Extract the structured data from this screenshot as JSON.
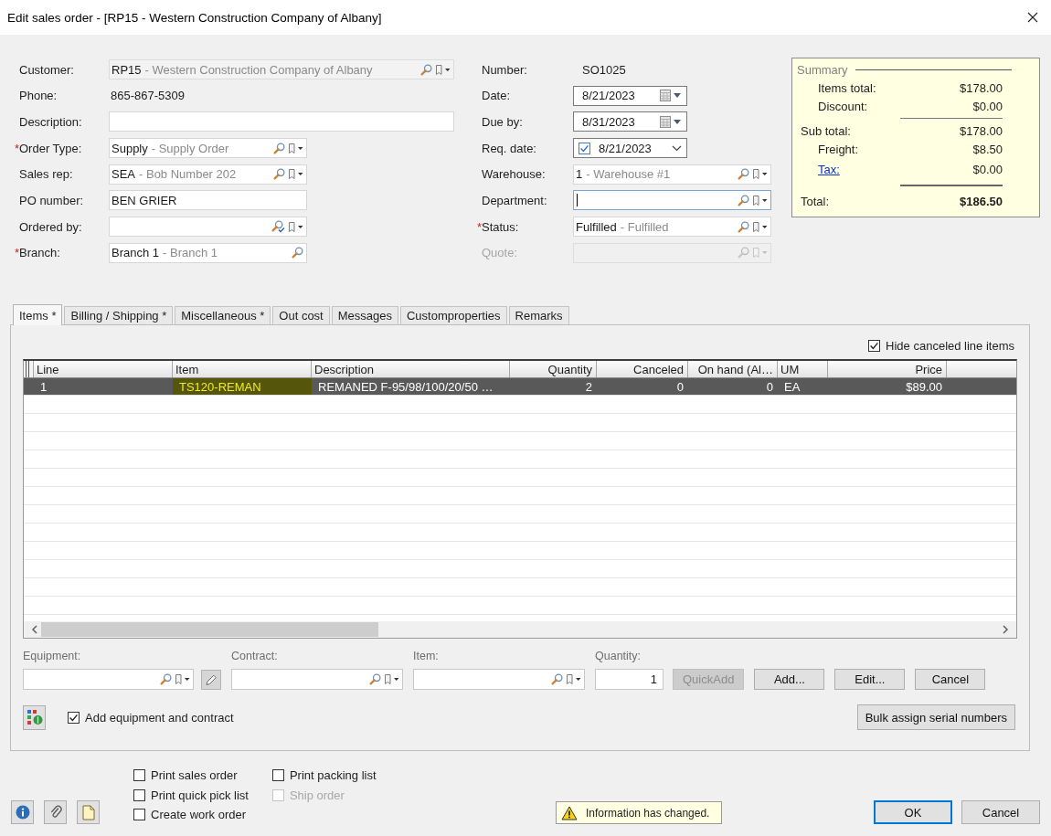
{
  "window": {
    "title": "Edit sales order - [RP15 - Western Construction Company of Albany]"
  },
  "form": {
    "left": [
      {
        "label": "Customer:",
        "kind": "readonly-lookup",
        "code": "RP15",
        "description": "- Western Construction Company of Albany",
        "disabled": false,
        "focused": false
      },
      {
        "label": "Phone:",
        "kind": "plain",
        "value": "865-867-5309",
        "disabled": false
      },
      {
        "label": "Description:",
        "kind": "text",
        "disabled": false,
        "focused": false
      },
      {
        "marker": "*",
        "label": "Order Type:",
        "kind": "lookup",
        "code": "Supply",
        "description": "- Supply Order",
        "disabled": false,
        "focused": false
      },
      {
        "label": "Sales rep:",
        "kind": "lookup",
        "code": "SEA",
        "description": "- Bob Number 202",
        "disabled": false,
        "focused": false
      },
      {
        "label": "PO number:",
        "kind": "text",
        "value": "BEN GRIER",
        "disabled": false,
        "focused": false
      },
      {
        "label": "Ordered by:",
        "kind": "contact-lookup",
        "disabled": false,
        "focused": false
      },
      {
        "marker": "*",
        "label": "Branch:",
        "kind": "search-lookup",
        "code": "Branch 1",
        "description": "- Branch 1",
        "disabled": false,
        "focused": false
      }
    ],
    "right": [
      {
        "label": "Number:",
        "kind": "plain",
        "value": "SO1025",
        "disabled": false
      },
      {
        "label": "Date:",
        "kind": "date",
        "value": "8/21/2023",
        "disabled": false,
        "focused": false
      },
      {
        "label": "Due by:",
        "kind": "date",
        "value": "8/31/2023",
        "disabled": false,
        "focused": false
      },
      {
        "label": "Req. date:",
        "kind": "date-check",
        "value": "8/21/2023",
        "checked": true,
        "disabled": false,
        "focused": false
      },
      {
        "label": "Warehouse:",
        "kind": "lookup",
        "code": "1",
        "description": "- Warehouse #1",
        "disabled": false,
        "focused": false
      },
      {
        "label": "Department:",
        "kind": "lookup",
        "disabled": false,
        "focused": true
      },
      {
        "marker": "*",
        "label": "Status:",
        "kind": "lookup",
        "code": "Fulfilled",
        "description": "- Fulfilled",
        "disabled": false,
        "focused": false
      },
      {
        "label": "Quote:",
        "kind": "lookup",
        "disabled": true,
        "focused": false
      }
    ]
  },
  "summary": {
    "title": "Summary",
    "lines": [
      {
        "kind": "item",
        "label": "Items total:",
        "value": "$178.00"
      },
      {
        "kind": "item",
        "label": "Discount:",
        "value": "$0.00"
      },
      {
        "kind": "rule"
      },
      {
        "kind": "subtotal",
        "label": "Sub total:",
        "value": "$178.00"
      },
      {
        "kind": "item",
        "label": "Freight:",
        "value": "$8.50"
      },
      {
        "kind": "link",
        "label": "Tax:",
        "value": "$0.00"
      },
      {
        "kind": "double-rule"
      },
      {
        "kind": "total",
        "label": "Total:",
        "value": "$186.50"
      }
    ]
  },
  "tabs": [
    {
      "label": "Items *",
      "selected": true
    },
    {
      "label": "Billing / Shipping *",
      "selected": false
    },
    {
      "label": "Miscellaneous *",
      "selected": false
    },
    {
      "label": "Out cost",
      "selected": false
    },
    {
      "label": "Messages",
      "selected": false
    },
    {
      "label": "Customproperties",
      "selected": false
    },
    {
      "label": "Remarks",
      "selected": false
    }
  ],
  "items": {
    "hide_canceled": {
      "label": "Hide canceled line items",
      "checked": true
    },
    "grid": {
      "columns": [
        {
          "label": "Line",
          "kind": "text"
        },
        {
          "label": "Item",
          "kind": "text"
        },
        {
          "label": "Description",
          "kind": "text"
        },
        {
          "label": "Quantity",
          "kind": "number"
        },
        {
          "label": "Canceled",
          "kind": "number"
        },
        {
          "label": "On hand (Al…",
          "kind": "number"
        },
        {
          "label": "UM",
          "kind": "text"
        },
        {
          "label": "Price",
          "kind": "number"
        }
      ],
      "rows": [
        {
          "selected": true,
          "cells": [
            {
              "text": "1",
              "highlighted": false
            },
            {
              "text": "TS120-REMAN",
              "highlighted": true
            },
            {
              "text": "REMANED F-95/98/100/20/50 …",
              "highlighted": false
            },
            {
              "text": "2",
              "highlighted": false
            },
            {
              "text": "0",
              "highlighted": false
            },
            {
              "text": "0",
              "highlighted": false
            },
            {
              "text": "EA",
              "highlighted": false
            },
            {
              "text": "$89.00",
              "highlighted": false
            }
          ]
        }
      ]
    }
  },
  "entry": {
    "fields": [
      {
        "label": "Equipment:",
        "kind": "lookup-edit"
      },
      {
        "label": "Contract:",
        "kind": "lookup"
      },
      {
        "label": "Item:",
        "kind": "lookup"
      },
      {
        "label": "Quantity:",
        "kind": "number",
        "value": "1"
      }
    ],
    "buttons": [
      {
        "label": "QuickAdd",
        "disabled": true
      },
      {
        "label": "Add...",
        "disabled": false
      },
      {
        "label": "Edit...",
        "disabled": false
      },
      {
        "label": "Cancel",
        "disabled": false
      }
    ],
    "option": {
      "label": "Add equipment and contract",
      "checked": true
    },
    "bulk_button": {
      "label": "Bulk assign serial numbers"
    }
  },
  "footer": {
    "options": [
      {
        "label": "Print sales order",
        "checked": false,
        "disabled": false
      },
      {
        "label": "Print quick pick list",
        "checked": false,
        "disabled": false
      },
      {
        "label": "Create work order",
        "checked": false,
        "disabled": false
      },
      {
        "label": "Print packing list",
        "checked": false,
        "disabled": false
      },
      {
        "label": "Ship order",
        "checked": false,
        "disabled": true
      }
    ],
    "message": {
      "text": "Information has changed."
    },
    "buttons": [
      {
        "label": "OK",
        "default": true
      },
      {
        "label": "Cancel",
        "default": false
      }
    ]
  }
}
